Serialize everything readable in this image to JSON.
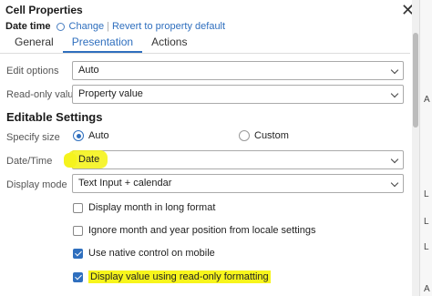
{
  "dialog": {
    "title": "Cell Properties",
    "field_name": "Date time",
    "change_link": "Change",
    "separator": "|",
    "revert_link": "Revert to property default"
  },
  "tabs": [
    {
      "label": "General",
      "active": false
    },
    {
      "label": "Presentation",
      "active": true
    },
    {
      "label": "Actions",
      "active": false
    }
  ],
  "rows": {
    "edit_options": {
      "label": "Edit options",
      "value": "Auto"
    },
    "read_only_value": {
      "label": "Read-only value",
      "value": "Property value"
    }
  },
  "editable_settings": {
    "heading": "Editable Settings",
    "specify_size": {
      "label": "Specify size",
      "options": [
        "Auto",
        "Custom"
      ],
      "selected": "Auto"
    },
    "date_time": {
      "label": "Date/Time",
      "value": "Date"
    },
    "display_mode": {
      "label": "Display mode",
      "value": "Text Input + calendar"
    },
    "checkboxes": [
      {
        "label": "Display month in long format",
        "checked": false
      },
      {
        "label": "Ignore month and year position from locale settings",
        "checked": false
      },
      {
        "label": "Use native control on mobile",
        "checked": true
      },
      {
        "label": "Display value using read-only formatting",
        "checked": true
      }
    ]
  },
  "background_letters": [
    "A",
    "L",
    "L",
    "L",
    "A"
  ],
  "highlight_color": "#f7f51c",
  "accent_color": "#2f6fbe"
}
